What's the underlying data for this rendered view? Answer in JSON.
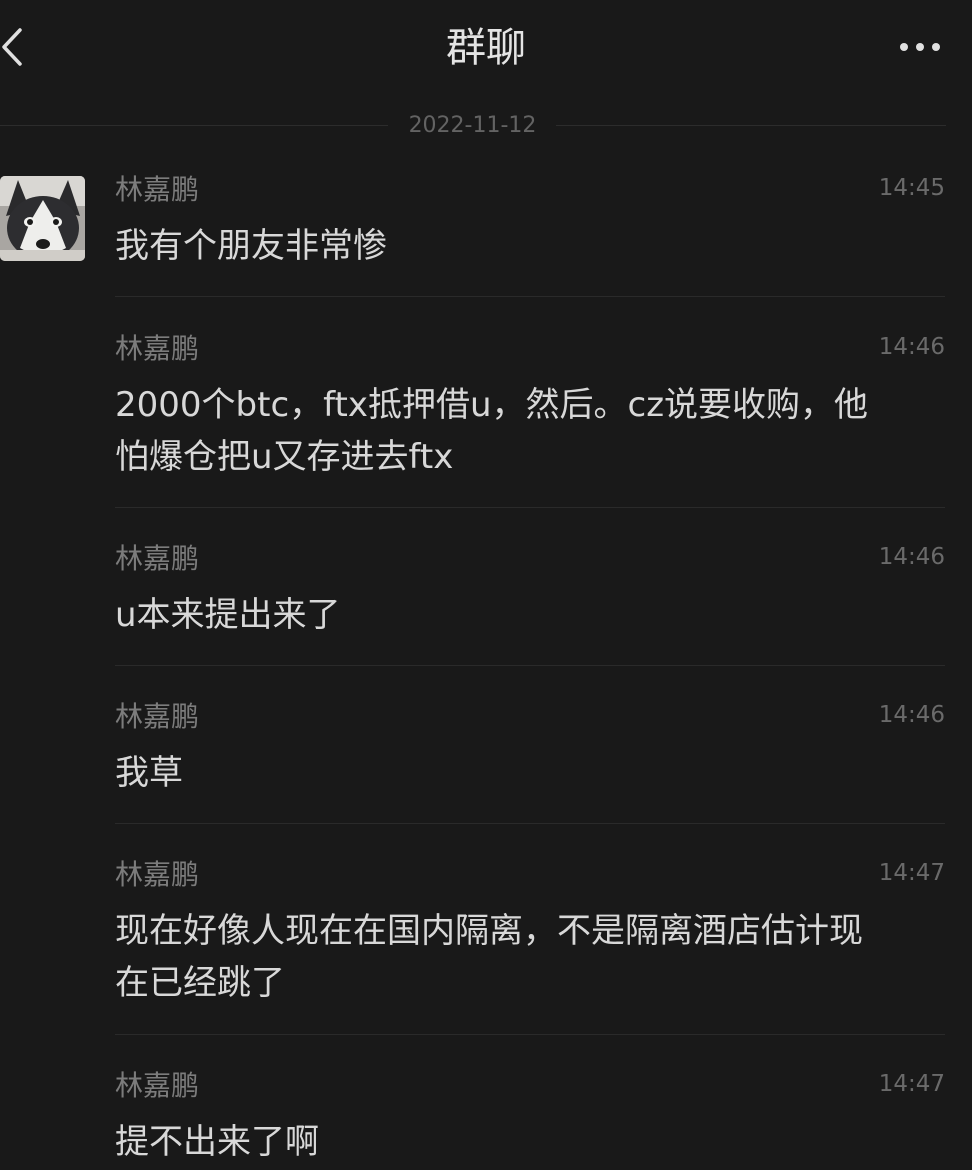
{
  "header": {
    "title": "群聊"
  },
  "date_separator": "2022-11-12",
  "messages": [
    {
      "sender": "林嘉鹏",
      "time": "14:45",
      "text": "我有个朋友非常惨"
    },
    {
      "sender": "林嘉鹏",
      "time": "14:46",
      "text": "2000个btc，ftx抵押借u，然后。cz说要收购，他\n怕爆仓把u又存进去ftx"
    },
    {
      "sender": "林嘉鹏",
      "time": "14:46",
      "text": "u本来提出来了"
    },
    {
      "sender": "林嘉鹏",
      "time": "14:46",
      "text": "我草"
    },
    {
      "sender": "林嘉鹏",
      "time": "14:47",
      "text": "现在好像人现在在国内隔离，不是隔离酒店估计现\n在已经跳了"
    },
    {
      "sender": "林嘉鹏",
      "time": "14:47",
      "text": "提不出来了啊"
    }
  ],
  "icons": {
    "back": "chevron-left-icon",
    "more": "more-dots-icon",
    "avatar": "husky-dog-avatar"
  },
  "colors": {
    "background": "#191919",
    "text": "#d8d8d8",
    "muted": "#7c7c7c"
  }
}
